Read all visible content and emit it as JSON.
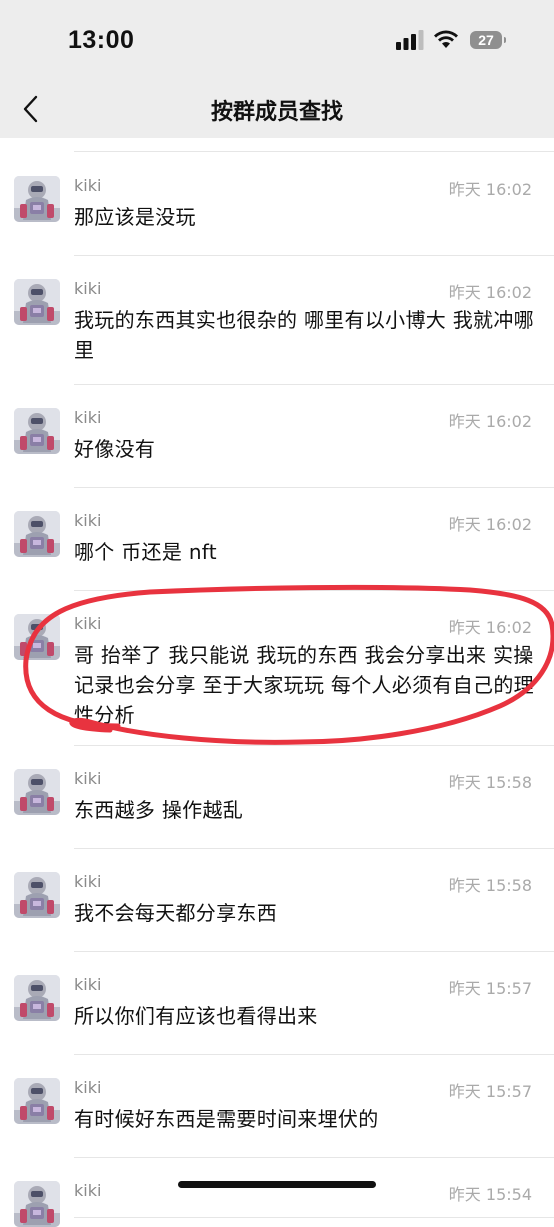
{
  "status_bar": {
    "time": "13:00",
    "battery": "27"
  },
  "header": {
    "title": "按群成员查找"
  },
  "messages": [
    {
      "sender": "kiki",
      "time": "昨天 16:02",
      "text": "那应该是没玩"
    },
    {
      "sender": "kiki",
      "time": "昨天 16:02",
      "text": "我玩的东西其实也很杂的 哪里有以小博大 我就冲哪里"
    },
    {
      "sender": "kiki",
      "time": "昨天 16:02",
      "text": "好像没有"
    },
    {
      "sender": "kiki",
      "time": "昨天 16:02",
      "text": "哪个 币还是 nft"
    },
    {
      "sender": "kiki",
      "time": "昨天 16:02",
      "text": "哥 抬举了 我只能说 我玩的东西 我会分享出来 实操记录也会分享 至于大家玩玩 每个人必须有自己的理性分析"
    },
    {
      "sender": "kiki",
      "time": "昨天 15:58",
      "text": "东西越多 操作越乱"
    },
    {
      "sender": "kiki",
      "time": "昨天 15:58",
      "text": "我不会每天都分享东西"
    },
    {
      "sender": "kiki",
      "time": "昨天 15:57",
      "text": "所以你们有应该也看得出来"
    },
    {
      "sender": "kiki",
      "time": "昨天 15:57",
      "text": "有时候好东西是需要时间来埋伏的"
    },
    {
      "sender": "kiki",
      "time": "昨天 15:54",
      "text": ""
    }
  ],
  "colors": {
    "header_bg": "#ededed",
    "annotation": "#e8333f"
  }
}
